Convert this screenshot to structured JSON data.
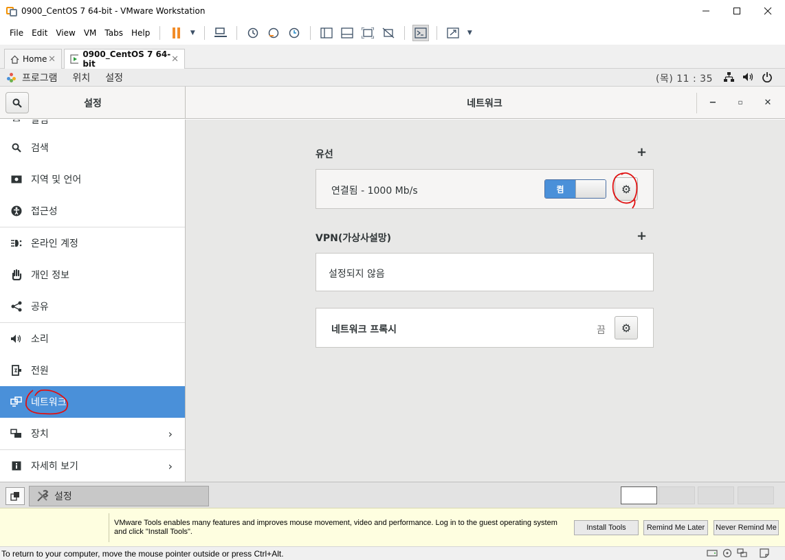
{
  "window": {
    "title": "0900_CentOS 7 64-bit - VMware Workstation",
    "minimize_icon": "minimize-icon",
    "maximize_icon": "maximize-icon",
    "close_icon": "close-icon"
  },
  "menu": {
    "items": [
      "File",
      "Edit",
      "View",
      "VM",
      "Tabs",
      "Help"
    ]
  },
  "tabs": [
    {
      "label": "Home",
      "icon": "home-icon",
      "close": "✕"
    },
    {
      "label": "0900_CentOS 7 64-bit",
      "icon": "vm-icon",
      "close": "✕"
    }
  ],
  "gnome_top": {
    "menus": [
      "프로그램",
      "위치",
      "설정"
    ],
    "clock": "(목) 11 : 35"
  },
  "settings_header": {
    "left_title": "설정",
    "main_title": "네트워크",
    "minimize": "−",
    "maximize": "▫",
    "close": "✕"
  },
  "sidebar": {
    "partial_item": "알림",
    "items": [
      {
        "label": "검색",
        "icon": "search-icon",
        "chevron": ""
      },
      {
        "label": "지역 및 언어",
        "icon": "region-icon",
        "chevron": ""
      },
      {
        "label": "접근성",
        "icon": "accessibility-icon",
        "chevron": ""
      },
      {
        "label": "온라인 계정",
        "icon": "online-accounts-icon",
        "chevron": ""
      },
      {
        "label": "개인 정보",
        "icon": "privacy-hand-icon",
        "chevron": ""
      },
      {
        "label": "공유",
        "icon": "share-icon",
        "chevron": ""
      },
      {
        "label": "소리",
        "icon": "sound-icon",
        "chevron": ""
      },
      {
        "label": "전원",
        "icon": "power-icon",
        "chevron": ""
      },
      {
        "label": "네트워크",
        "icon": "network-icon",
        "chevron": "",
        "selected": true
      },
      {
        "label": "장치",
        "icon": "devices-icon",
        "chevron": "›"
      },
      {
        "label": "자세히 보기",
        "icon": "info-icon",
        "chevron": "›"
      }
    ]
  },
  "network": {
    "wired": {
      "title": "유선",
      "add": "+",
      "status": "연결됨 - 1000 Mb/s",
      "toggle_label": "켬",
      "toggle_on": true
    },
    "vpn": {
      "title": "VPN(가상사설망)",
      "add": "+",
      "status": "설정되지 않음"
    },
    "proxy": {
      "title": "네트워크 프록시",
      "status": "끔"
    }
  },
  "taskbar": {
    "window_label": "설정",
    "workspaces": 4,
    "active_workspace": 1
  },
  "tools_bar": {
    "message": "VMware Tools enables many features and improves mouse movement, video and performance. Log in to the guest operating system and click \"Install Tools\".",
    "install": "Install Tools",
    "remind": "Remind Me Later",
    "never": "Never Remind Me"
  },
  "statusbar": {
    "text": "To return to your computer, move the mouse pointer outside or press Ctrl+Alt."
  },
  "colors": {
    "selected": "#4a90d9",
    "annotation": "#e01010",
    "pause": "#f28c28"
  }
}
